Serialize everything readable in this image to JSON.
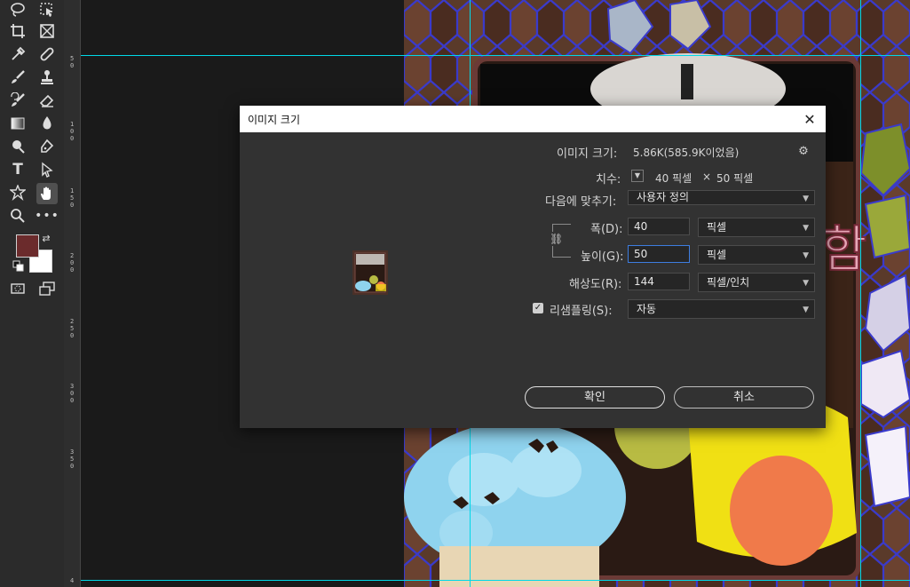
{
  "ruler": {
    "labels": [
      "5\n0",
      "1\n0\n0",
      "1\n5\n0",
      "2\n0\n0",
      "2\n5\n0",
      "3\n0\n0",
      "3\n5\n0",
      "4"
    ]
  },
  "toolbar": {
    "tools": [
      "lasso-icon",
      "object-select-icon",
      "crop-icon",
      "frame-icon",
      "eyedropper-icon",
      "healing-brush-icon",
      "brush-icon",
      "stamp-icon",
      "history-brush-icon",
      "eraser-icon",
      "gradient-icon",
      "blur-icon",
      "dodge-icon",
      "pen-icon",
      "type-icon",
      "path-select-icon",
      "custom-shape-icon",
      "hand-icon",
      "zoom-icon",
      "more-tools-icon"
    ],
    "foreground_color": "#6b2b2c",
    "background_color": "#ffffff"
  },
  "dialog": {
    "title": "이미지 크기",
    "image_size_label": "이미지 크기:",
    "image_size_value": "5.86K(585.9K이었음)",
    "dimensions_label": "치수:",
    "dimensions_width": "40 픽셀",
    "dimensions_times": "×",
    "dimensions_height": "50 픽셀",
    "fit_to_label": "다음에 맞추기:",
    "fit_to_value": "사용자 정의",
    "width_label": "폭(D):",
    "width_value": "40",
    "width_unit": "픽셀",
    "height_label": "높이(G):",
    "height_value": "50",
    "height_unit": "픽셀",
    "resolution_label": "해상도(R):",
    "resolution_value": "144",
    "resolution_unit": "픽셀/인치",
    "resample_label": "리샘플링(S):",
    "resample_checked": true,
    "resample_value": "자동",
    "ok_label": "확인",
    "cancel_label": "취소"
  }
}
